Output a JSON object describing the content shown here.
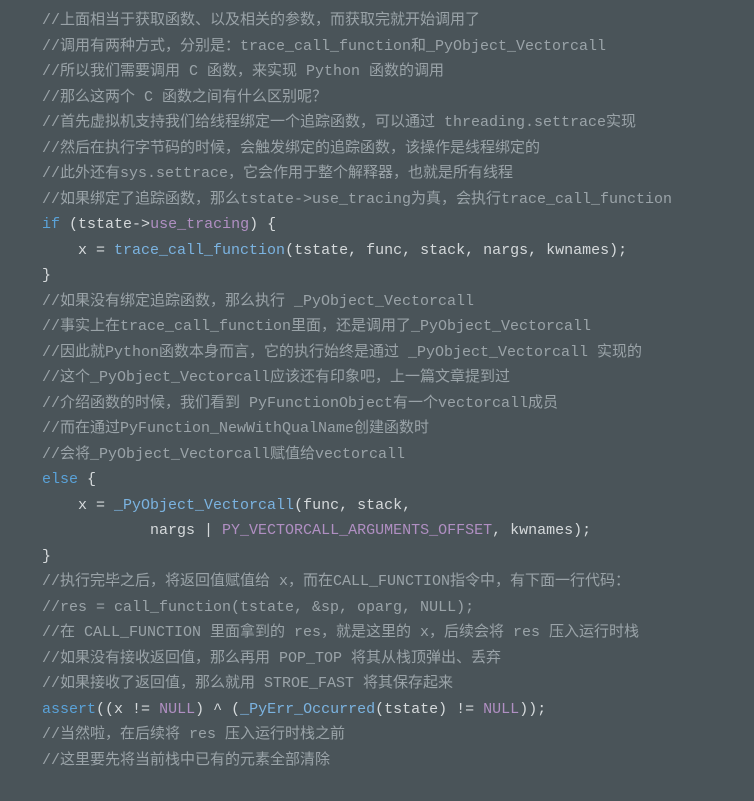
{
  "lines": [
    {
      "parts": [
        {
          "cls": "comment",
          "t": "//上面相当于获取函数、以及相关的参数，而获取完就开始调用了"
        }
      ]
    },
    {
      "parts": [
        {
          "cls": "comment",
          "t": "//调用有两种方式，分别是：trace_call_function和_PyObject_Vectorcall"
        }
      ]
    },
    {
      "parts": [
        {
          "cls": "comment",
          "t": "//所以我们需要调用 C 函数，来实现 Python 函数的调用"
        }
      ]
    },
    {
      "parts": [
        {
          "cls": "comment",
          "t": "//那么这两个 C 函数之间有什么区别呢？"
        }
      ]
    },
    {
      "parts": [
        {
          "cls": "comment",
          "t": "//首先虚拟机支持我们给线程绑定一个追踪函数，可以通过 threading.settrace实现"
        }
      ]
    },
    {
      "parts": [
        {
          "cls": "comment",
          "t": "//然后在执行字节码的时候，会触发绑定的追踪函数，该操作是线程绑定的"
        }
      ]
    },
    {
      "parts": [
        {
          "cls": "comment",
          "t": "//此外还有sys.settrace，它会作用于整个解释器，也就是所有线程"
        }
      ]
    },
    {
      "parts": [
        {
          "cls": "comment",
          "t": "//如果绑定了追踪函数，那么tstate->use_tracing为真，会执行trace_call_function"
        }
      ]
    },
    {
      "parts": [
        {
          "cls": "keyword",
          "t": "if"
        },
        {
          "cls": "punct",
          "t": " ("
        },
        {
          "cls": "ident",
          "t": "tstate"
        },
        {
          "cls": "arrow",
          "t": "->"
        },
        {
          "cls": "member",
          "t": "use_tracing"
        },
        {
          "cls": "punct",
          "t": ") {"
        }
      ]
    },
    {
      "parts": [
        {
          "cls": "ident",
          "t": "    x "
        },
        {
          "cls": "punct",
          "t": "= "
        },
        {
          "cls": "func",
          "t": "trace_call_function"
        },
        {
          "cls": "punct",
          "t": "("
        },
        {
          "cls": "ident",
          "t": "tstate, func, stack, nargs, kwnames"
        },
        {
          "cls": "punct",
          "t": ");"
        }
      ]
    },
    {
      "parts": [
        {
          "cls": "punct",
          "t": "}"
        }
      ]
    },
    {
      "parts": [
        {
          "cls": "comment",
          "t": "//如果没有绑定追踪函数，那么执行 _PyObject_Vectorcall"
        }
      ]
    },
    {
      "parts": [
        {
          "cls": "comment",
          "t": "//事实上在trace_call_function里面，还是调用了_PyObject_Vectorcall"
        }
      ]
    },
    {
      "parts": [
        {
          "cls": "comment",
          "t": "//因此就Python函数本身而言，它的执行始终是通过 _PyObject_Vectorcall 实现的"
        }
      ]
    },
    {
      "parts": [
        {
          "cls": "comment",
          "t": "//这个_PyObject_Vectorcall应该还有印象吧，上一篇文章提到过"
        }
      ]
    },
    {
      "parts": [
        {
          "cls": "comment",
          "t": "//介绍函数的时候，我们看到 PyFunctionObject有一个vectorcall成员"
        }
      ]
    },
    {
      "parts": [
        {
          "cls": "comment",
          "t": "//而在通过PyFunction_NewWithQualName创建函数时"
        }
      ]
    },
    {
      "parts": [
        {
          "cls": "comment",
          "t": "//会将_PyObject_Vectorcall赋值给vectorcall"
        }
      ]
    },
    {
      "parts": [
        {
          "cls": "keyword",
          "t": "else"
        },
        {
          "cls": "punct",
          "t": " {"
        }
      ]
    },
    {
      "parts": [
        {
          "cls": "ident",
          "t": "    x "
        },
        {
          "cls": "punct",
          "t": "= "
        },
        {
          "cls": "func",
          "t": "_PyObject_Vectorcall"
        },
        {
          "cls": "punct",
          "t": "("
        },
        {
          "cls": "ident",
          "t": "func, stack,"
        }
      ]
    },
    {
      "parts": [
        {
          "cls": "ident",
          "t": "            nargs "
        },
        {
          "cls": "punct",
          "t": "| "
        },
        {
          "cls": "const",
          "t": "PY_VECTORCALL_ARGUMENTS_OFFSET"
        },
        {
          "cls": "ident",
          "t": ", kwnames"
        },
        {
          "cls": "punct",
          "t": ");"
        }
      ]
    },
    {
      "parts": [
        {
          "cls": "punct",
          "t": "}"
        }
      ]
    },
    {
      "parts": [
        {
          "cls": "comment",
          "t": "//执行完毕之后，将返回值赋值给 x，而在CALL_FUNCTION指令中，有下面一行代码："
        }
      ]
    },
    {
      "parts": [
        {
          "cls": "comment",
          "t": "//res = call_function(tstate, &sp, oparg, NULL);"
        }
      ]
    },
    {
      "parts": [
        {
          "cls": "comment",
          "t": "//在 CALL_FUNCTION 里面拿到的 res，就是这里的 x，后续会将 res 压入运行时栈"
        }
      ]
    },
    {
      "parts": [
        {
          "cls": "comment",
          "t": "//如果没有接收返回值，那么再用 POP_TOP 将其从栈顶弹出、丢弃"
        }
      ]
    },
    {
      "parts": [
        {
          "cls": "comment",
          "t": "//如果接收了返回值，那么就用 STROE_FAST 将其保存起来"
        }
      ]
    },
    {
      "parts": [
        {
          "cls": "keyword",
          "t": "assert"
        },
        {
          "cls": "punct",
          "t": "(("
        },
        {
          "cls": "ident",
          "t": "x "
        },
        {
          "cls": "punct",
          "t": "!= "
        },
        {
          "cls": "const",
          "t": "NULL"
        },
        {
          "cls": "punct",
          "t": ") ^ ("
        },
        {
          "cls": "func",
          "t": "_PyErr_Occurred"
        },
        {
          "cls": "punct",
          "t": "("
        },
        {
          "cls": "ident",
          "t": "tstate"
        },
        {
          "cls": "punct",
          "t": ") != "
        },
        {
          "cls": "const",
          "t": "NULL"
        },
        {
          "cls": "punct",
          "t": "));"
        }
      ]
    },
    {
      "parts": [
        {
          "cls": "comment",
          "t": ""
        }
      ]
    },
    {
      "parts": [
        {
          "cls": "comment",
          "t": "//当然啦，在后续将 res 压入运行时栈之前"
        }
      ]
    },
    {
      "parts": [
        {
          "cls": "comment",
          "t": "//这里要先将当前栈中已有的元素全部清除"
        }
      ]
    }
  ]
}
